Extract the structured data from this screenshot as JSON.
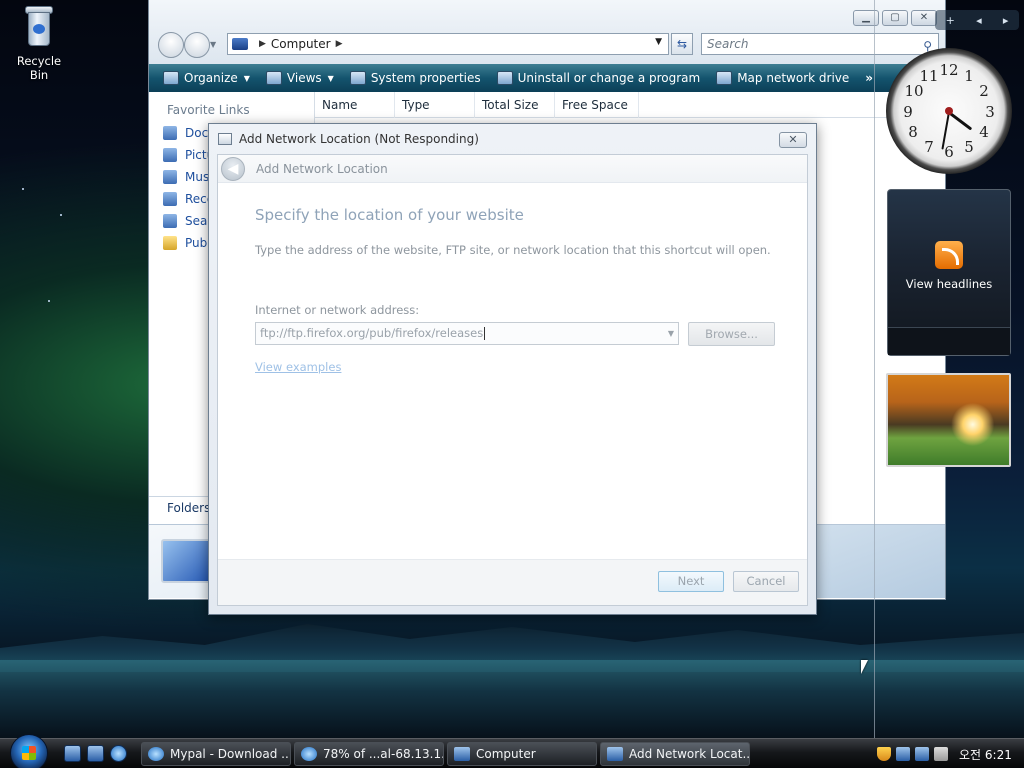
{
  "desktop": {
    "recycle_bin_label": "Recycle Bin"
  },
  "explorer": {
    "address": "Computer",
    "search_placeholder": "Search",
    "toolbar": [
      {
        "label": "Organize",
        "icon": "organize-icon",
        "dropdown": true
      },
      {
        "label": "Views",
        "icon": "views-icon",
        "dropdown": true
      },
      {
        "label": "System properties",
        "icon": "system-properties-icon"
      },
      {
        "label": "Uninstall or change a program",
        "icon": "uninstall-icon"
      },
      {
        "label": "Map network drive",
        "icon": "map-drive-icon"
      }
    ],
    "toolbar_more": "»",
    "favorite_links_heading": "Favorite Links",
    "favorite_links": [
      "Doc",
      "Pictu",
      "Mus",
      "Rece",
      "Sear",
      "Pub"
    ],
    "columns": [
      "Name",
      "Type",
      "Total Size",
      "Free Space"
    ],
    "folders_label": "Folders"
  },
  "dialog": {
    "title": "Add Network Location (Not Responding)",
    "nav_title": "Add Network Location",
    "close_glyph": "✕",
    "heading": "Specify the location of your website",
    "description": "Type the address of the website, FTP site, or network location that this shortcut will open.",
    "address_label": "Internet or network address:",
    "address_value": "ftp://ftp.firefox.org/pub/firefox/releases",
    "browse_label": "Browse...",
    "examples_link": "View examples",
    "next_label": "Next",
    "cancel_label": "Cancel"
  },
  "sidebar": {
    "controls": [
      "+",
      "◂",
      "▸"
    ],
    "clock_numbers": [
      "12",
      "1",
      "2",
      "3",
      "4",
      "5",
      "6",
      "7",
      "8",
      "9",
      "10",
      "11"
    ],
    "feeds_label": "View headlines"
  },
  "taskbar": {
    "tasks": [
      {
        "label": "Mypal - Download ...",
        "icon": "ie"
      },
      {
        "label": "78% of ...al-68.13.1....",
        "icon": "ie"
      },
      {
        "label": "Computer",
        "icon": "pc"
      },
      {
        "label": "Add Network Locat...",
        "icon": "window"
      }
    ],
    "clock": "오전 6:21"
  }
}
